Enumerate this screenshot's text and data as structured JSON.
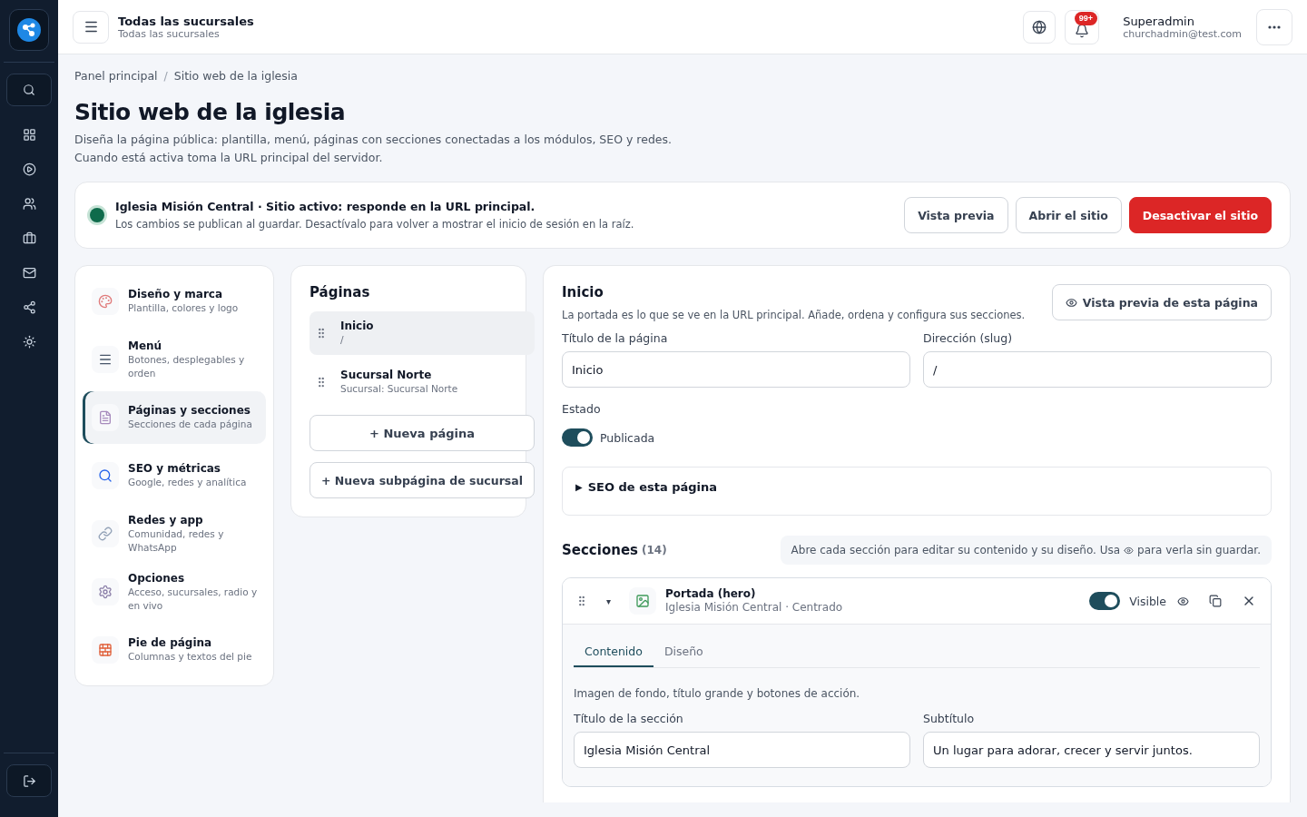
{
  "topbar": {
    "branch_title": "Todas las sucursales",
    "branch_subtitle": "Todas las sucursales",
    "notifications_badge": "99+",
    "user_name": "Superadmin",
    "user_email": "churchadmin@test.com"
  },
  "breadcrumb": [
    "Panel principal",
    "/",
    "Sitio web de la iglesia"
  ],
  "page": {
    "title": "Sitio web de la iglesia",
    "description": [
      "Diseña la página pública: plantilla, menú, páginas con secciones conectadas a los módulos, SEO y redes.",
      "Cuando está activa toma la URL principal del servidor."
    ]
  },
  "status_card": {
    "active": true,
    "title": "Iglesia Misión Central · Sitio activo: responde en la URL principal.",
    "text": "Los cambios se publican al guardar. Desactívalo para volver a mostrar el inicio de sesión en la raíz.",
    "buttons": [
      {
        "label": "Vista previa",
        "kind": "outline"
      },
      {
        "label": "Abrir el sitio",
        "kind": "outline"
      },
      {
        "label": "Desactivar el sitio",
        "kind": "danger"
      }
    ]
  },
  "settings_nav": [
    {
      "title": "Diseño y marca",
      "subtitle": "Plantilla, colores y logo",
      "selected": false
    },
    {
      "title": "Menú",
      "subtitle": "Botones, desplegables y orden",
      "selected": false
    },
    {
      "title": "Páginas y secciones",
      "subtitle": "Secciones de cada página",
      "selected": true
    },
    {
      "title": "SEO y métricas",
      "subtitle": "Google, redes y analítica",
      "selected": false
    },
    {
      "title": "Redes y app",
      "subtitle": "Comunidad, redes y WhatsApp",
      "selected": false
    },
    {
      "title": "Opciones",
      "subtitle": "Acceso, sucursales, radio y en vivo",
      "selected": false
    },
    {
      "title": "Pie de página",
      "subtitle": "Columnas y textos del pie",
      "selected": false
    }
  ],
  "pages_panel": {
    "title": "Páginas",
    "pages": [
      {
        "title": "Inicio",
        "subtitle": "/",
        "selected": true
      },
      {
        "title": "Sucursal Norte",
        "subtitle": "Sucursal: Sucursal Norte",
        "selected": false
      }
    ],
    "buttons": [
      "+ Nueva página",
      "+ Nueva subpágina de sucursal"
    ]
  },
  "editor": {
    "title": "Inicio",
    "description": "La portada es lo que se ve en la URL principal. Añade, ordena y configura sus secciones.",
    "preview_button": "Vista previa de esta página",
    "fields": [
      {
        "label": "Título de la página",
        "value": "Inicio"
      },
      {
        "label": "Dirección (slug)",
        "value": "/"
      }
    ],
    "status_label": "Estado",
    "published": true,
    "published_label": "Publicada",
    "seo_toggle": "▶",
    "seo_title": "SEO de esta página",
    "sections_title": "Secciones",
    "sections_count": "(14)",
    "sections_hint_before": "Abre cada sección para editar su contenido y su diseño. Usa",
    "sections_hint_after": "para verla sin guardar.",
    "section": {
      "toggle": "▾",
      "title": "Portada (hero)",
      "subtitle": "Iglesia Misión Central · Centrado",
      "visible": true,
      "visible_label": "Visible",
      "tabs": [
        {
          "label": "Contenido",
          "selected": true
        },
        {
          "label": "Diseño",
          "selected": false
        }
      ],
      "description": "Imagen de fondo, título grande y botones de acción.",
      "fields": [
        {
          "label": "Título de la sección",
          "value": "Iglesia Misión Central"
        },
        {
          "label": "Subtítulo",
          "value": "Un lugar para adorar, crecer y servir juntos."
        }
      ]
    }
  }
}
